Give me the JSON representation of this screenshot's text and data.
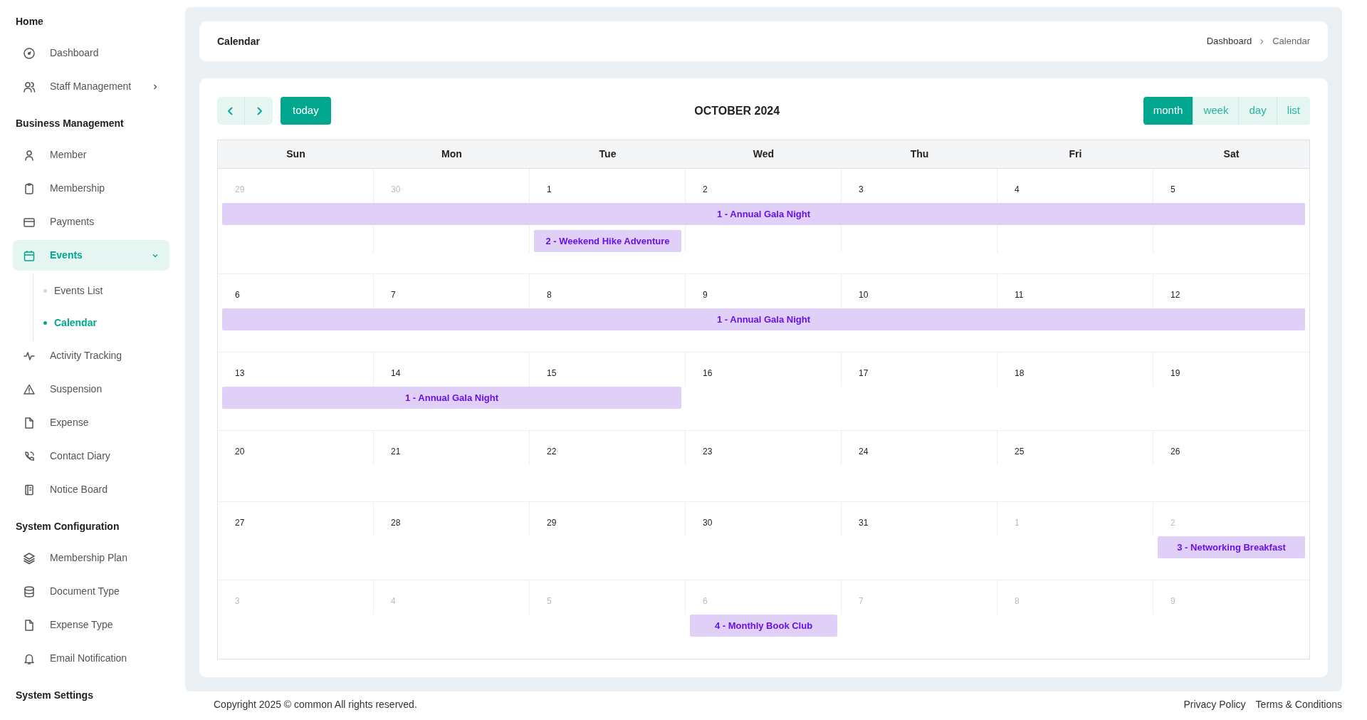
{
  "sidebar": {
    "sections": [
      {
        "title": "Home",
        "items": [
          {
            "label": "Dashboard",
            "selected": false
          },
          {
            "label": "Staff Management",
            "selected": false,
            "expanded": false
          }
        ]
      },
      {
        "title": "Business Management",
        "items": [
          {
            "label": "Member",
            "selected": false
          },
          {
            "label": "Membership",
            "selected": false
          },
          {
            "label": "Payments",
            "selected": false
          },
          {
            "label": "Events",
            "selected": true,
            "expanded": true,
            "children": [
              {
                "label": "Events List",
                "selected": false
              },
              {
                "label": "Calendar",
                "selected": true
              }
            ]
          },
          {
            "label": "Activity Tracking",
            "selected": false
          },
          {
            "label": "Suspension",
            "selected": false
          },
          {
            "label": "Expense",
            "selected": false
          },
          {
            "label": "Contact Diary",
            "selected": false
          },
          {
            "label": "Notice Board",
            "selected": false
          }
        ]
      },
      {
        "title": "System Configuration",
        "items": [
          {
            "label": "Membership Plan",
            "selected": false
          },
          {
            "label": "Document Type",
            "selected": false
          },
          {
            "label": "Expense Type",
            "selected": false
          },
          {
            "label": "Email Notification",
            "selected": false
          }
        ]
      },
      {
        "title": "System Settings"
      }
    ]
  },
  "page_header": {
    "title": "Calendar",
    "breadcrumb": [
      "Dashboard",
      "Calendar"
    ]
  },
  "calendar": {
    "title": "OCTOBER 2024",
    "today_button": "today",
    "views": [
      {
        "label": "month",
        "selected": true
      },
      {
        "label": "week",
        "selected": false
      },
      {
        "label": "day",
        "selected": false
      },
      {
        "label": "list",
        "selected": false
      }
    ],
    "columns": [
      "Sun",
      "Mon",
      "Tue",
      "Wed",
      "Thu",
      "Fri",
      "Sat"
    ],
    "weeks": [
      {
        "days": [
          {
            "day": "29",
            "other_month": true,
            "events": [
              {
                "kind": "start",
                "label": "1 - Annual Gala Night"
              }
            ]
          },
          {
            "day": "30",
            "other_month": true,
            "events": [
              {
                "kind": "continued"
              }
            ]
          },
          {
            "day": "1",
            "other_month": false,
            "events": [
              {
                "kind": "continued"
              },
              {
                "kind": "start",
                "label": "2 - Weekend Hike Adventure"
              }
            ]
          },
          {
            "day": "2",
            "other_month": false,
            "events": [
              {
                "kind": "continued"
              }
            ]
          },
          {
            "day": "3",
            "other_month": false,
            "events": [
              {
                "kind": "continued"
              }
            ]
          },
          {
            "day": "4",
            "other_month": false,
            "events": [
              {
                "kind": "continued"
              }
            ]
          },
          {
            "day": "5",
            "other_month": false,
            "events": [
              {
                "kind": "continued"
              }
            ]
          }
        ]
      },
      {
        "days": [
          {
            "day": "6",
            "other_month": false,
            "events": [
              {
                "kind": "start",
                "label": "1 - Annual Gala Night"
              }
            ]
          },
          {
            "day": "7",
            "other_month": false,
            "events": [
              {
                "kind": "continued"
              }
            ]
          },
          {
            "day": "8",
            "other_month": false,
            "events": [
              {
                "kind": "continued"
              }
            ]
          },
          {
            "day": "9",
            "other_month": false,
            "events": [
              {
                "kind": "continued"
              }
            ]
          },
          {
            "day": "10",
            "other_month": false,
            "events": [
              {
                "kind": "continued"
              }
            ]
          },
          {
            "day": "11",
            "other_month": false,
            "events": [
              {
                "kind": "continued"
              }
            ]
          },
          {
            "day": "12",
            "other_month": false,
            "events": [
              {
                "kind": "continued"
              }
            ]
          }
        ]
      },
      {
        "days": [
          {
            "day": "13",
            "other_month": false,
            "events": [
              {
                "kind": "start",
                "label": "1 - Annual Gala Night"
              }
            ]
          },
          {
            "day": "14",
            "other_month": false,
            "events": [
              {
                "kind": "continued"
              }
            ]
          },
          {
            "day": "15",
            "other_month": false,
            "events": [
              {
                "kind": "continued"
              }
            ]
          },
          {
            "day": "16",
            "other_month": false
          },
          {
            "day": "17",
            "other_month": false
          },
          {
            "day": "18",
            "other_month": false
          },
          {
            "day": "19",
            "other_month": false
          }
        ]
      },
      {
        "days": [
          {
            "day": "20",
            "other_month": false
          },
          {
            "day": "21",
            "other_month": false
          },
          {
            "day": "22",
            "other_month": false
          },
          {
            "day": "23",
            "other_month": false
          },
          {
            "day": "24",
            "other_month": false
          },
          {
            "day": "25",
            "other_month": false
          },
          {
            "day": "26",
            "other_month": false
          }
        ]
      },
      {
        "days": [
          {
            "day": "27",
            "other_month": false
          },
          {
            "day": "28",
            "other_month": false
          },
          {
            "day": "29",
            "other_month": false
          },
          {
            "day": "30",
            "other_month": false
          },
          {
            "day": "31",
            "other_month": false
          },
          {
            "day": "1",
            "other_month": true
          },
          {
            "day": "2",
            "other_month": true,
            "events": [
              {
                "kind": "start",
                "label": "3 - Networking Breakfast"
              }
            ]
          }
        ]
      },
      {
        "days": [
          {
            "day": "3",
            "other_month": true
          },
          {
            "day": "4",
            "other_month": true
          },
          {
            "day": "5",
            "other_month": true
          },
          {
            "day": "6",
            "other_month": true,
            "events": [
              {
                "kind": "start",
                "label": "4 - Monthly Book Club"
              }
            ]
          },
          {
            "day": "7",
            "other_month": true
          },
          {
            "day": "8",
            "other_month": true
          },
          {
            "day": "9",
            "other_month": true
          }
        ]
      }
    ]
  },
  "footer": {
    "copyright": "Copyright 2025 © common All rights reserved.",
    "links": [
      "Privacy Policy",
      "Terms & Conditions"
    ]
  }
}
